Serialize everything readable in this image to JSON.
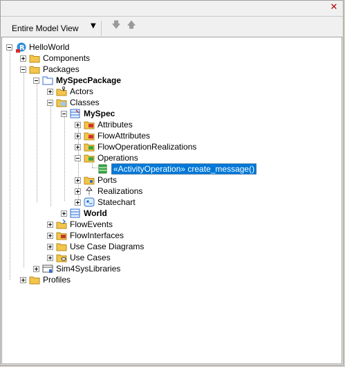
{
  "window": {
    "close_icon": "close-icon"
  },
  "toolbar": {
    "view_label": "Entire Model View",
    "nav_down_icon": "arrow-down-icon",
    "nav_up_icon": "arrow-up-icon"
  },
  "tree": {
    "root": "HelloWorld",
    "components": "Components",
    "packages": "Packages",
    "myspecpackage": "MySpecPackage",
    "actors": "Actors",
    "classes": "Classes",
    "myspec": "MySpec",
    "attributes": "Attributes",
    "flowattributes": "FlowAttributes",
    "flowoprealizations": "FlowOperationRealizations",
    "operations": "Operations",
    "selected_op": "«ActivityOperation» create_message()",
    "ports": "Ports",
    "realizations": "Realizations",
    "statechart": "Statechart",
    "world": "World",
    "flowevents": "FlowEvents",
    "flowinterfaces": "FlowInterfaces",
    "usecasediagrams": "Use Case Diagrams",
    "usecases": "Use Cases",
    "sim4sys": "Sim4SysLibraries",
    "profiles": "Profiles"
  },
  "colors": {
    "selection": "#0078d7",
    "folder": "#f3c54a"
  }
}
